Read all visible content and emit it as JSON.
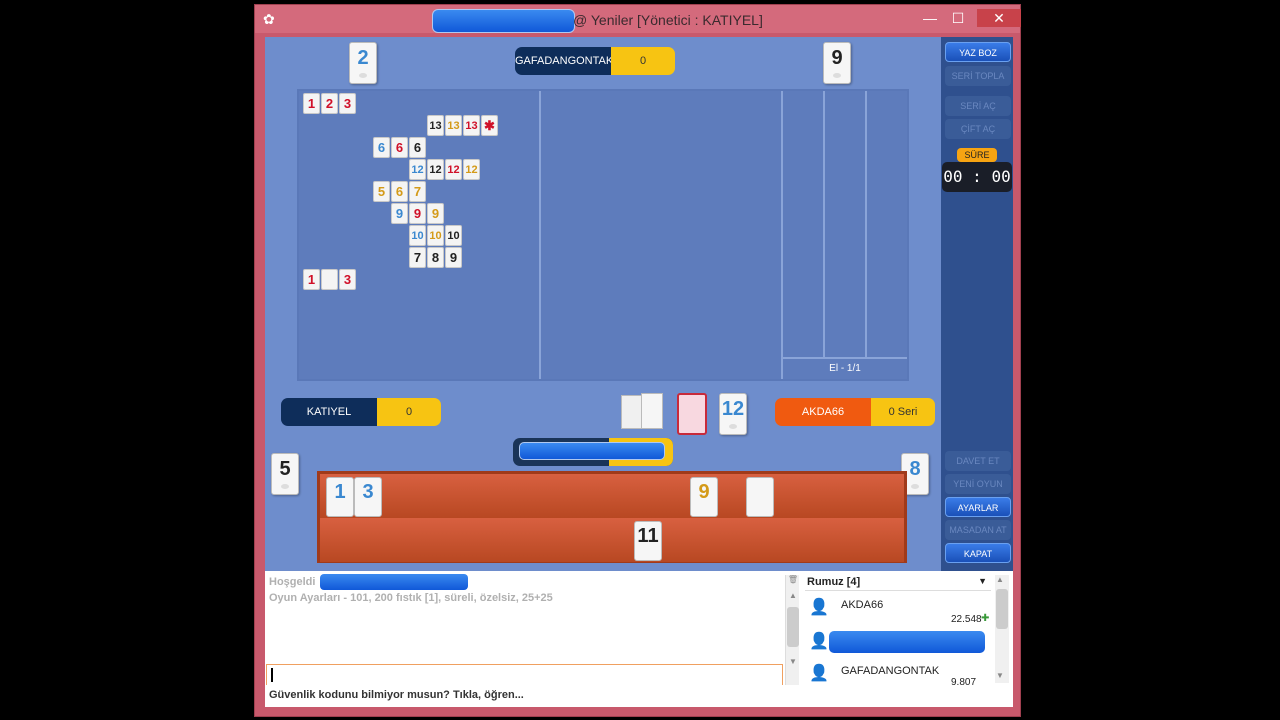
{
  "window": {
    "title": "@ Yeniler [Yönetici : KATIYEL]",
    "minimize": "—",
    "maximize": "☐",
    "close": "✕"
  },
  "players": {
    "top_left_tile": "2",
    "top_right_tile": "9",
    "top_name": "GAFADANGONTAK",
    "top_score": "0",
    "left_name": "KATIYEL",
    "left_score": "0",
    "right_name": "AKDA66",
    "right_score": "0 Seri",
    "left_side_tile": "5",
    "right_side_tile": "8",
    "center_tile": "12"
  },
  "board_status": "El - 1/1",
  "board_groups": [
    [
      {
        "n": "1",
        "c": "red"
      },
      {
        "n": "2",
        "c": "red"
      },
      {
        "n": "3",
        "c": "red"
      }
    ],
    [
      {
        "n": "13",
        "c": "black"
      },
      {
        "n": "13",
        "c": "yellow"
      },
      {
        "n": "13",
        "c": "red"
      },
      {
        "n": "✱",
        "c": "red"
      }
    ],
    [
      {
        "n": "6",
        "c": "blue"
      },
      {
        "n": "6",
        "c": "red"
      },
      {
        "n": "6",
        "c": "black"
      }
    ],
    [
      {
        "n": "12",
        "c": "blue"
      },
      {
        "n": "12",
        "c": "black"
      },
      {
        "n": "12",
        "c": "red"
      },
      {
        "n": "12",
        "c": "yellow"
      }
    ],
    [
      {
        "n": "5",
        "c": "yellow"
      },
      {
        "n": "6",
        "c": "yellow"
      },
      {
        "n": "7",
        "c": "yellow"
      }
    ],
    [
      {
        "n": "9",
        "c": "blue"
      },
      {
        "n": "9",
        "c": "red"
      },
      {
        "n": "9",
        "c": "yellow"
      }
    ],
    [
      {
        "n": "10",
        "c": "blue"
      },
      {
        "n": "10",
        "c": "yellow"
      },
      {
        "n": "10",
        "c": "black"
      }
    ],
    [
      {
        "n": "7",
        "c": "black"
      },
      {
        "n": "8",
        "c": "black"
      },
      {
        "n": "9",
        "c": "black"
      }
    ],
    [
      {
        "n": "1",
        "c": "red"
      },
      {
        "n": "",
        "c": "black"
      },
      {
        "n": "3",
        "c": "red"
      }
    ]
  ],
  "rack": {
    "row1": [
      {
        "n": "1",
        "c": "blue"
      },
      {
        "n": "3",
        "c": "blue"
      },
      {
        "n": "9",
        "c": "yellow"
      },
      {
        "n": "",
        "c": "black"
      }
    ],
    "row2": [
      {
        "n": "11",
        "c": "black"
      }
    ]
  },
  "side_buttons": {
    "yaz_boz": "YAZ BOZ",
    "seri_topla": "SERİ TOPLA",
    "seri_ac": "SERİ AÇ",
    "cift_ac": "ÇİFT AÇ",
    "sure_label": "SÜRE",
    "timer": "00 : 00",
    "davet_et": "DAVET ET",
    "yeni_oyun": "YENİ OYUN",
    "ayarlar": "AYARLAR",
    "masadan_at": "MASADAN AT",
    "kapat": "KAPAT"
  },
  "chat": {
    "welcome": "Hoşgeldi",
    "settings_line": "Oyun Ayarları - 101, 200 fıstık [1], süreli, özelsiz, 25+25",
    "input_value": "",
    "footer": "Güvenlik kodunu bilmiyor musun? Tıkla, öğren..."
  },
  "users": {
    "header": "Rumuz [4]",
    "list": [
      {
        "name": "AKDA66",
        "score": "22.548"
      },
      {
        "name": "",
        "score": ""
      },
      {
        "name": "GAFADANGONTAK",
        "score": "9.807"
      }
    ]
  }
}
